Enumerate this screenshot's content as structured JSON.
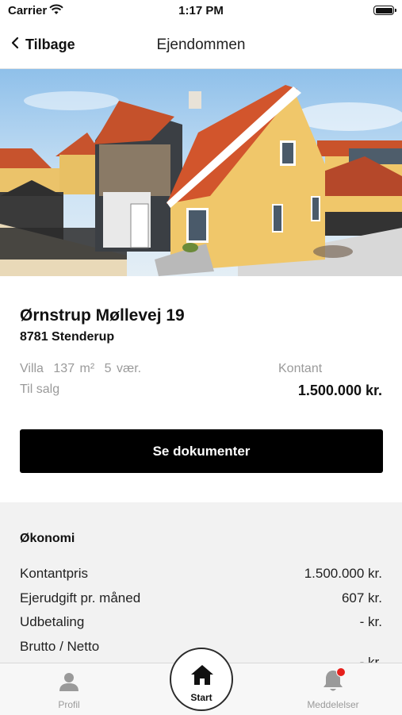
{
  "status_bar": {
    "carrier": "Carrier",
    "time": "1:17 PM"
  },
  "nav": {
    "back_label": "Tilbage",
    "title": "Ejendommen"
  },
  "property": {
    "address": "Ørnstrup Møllevej 19",
    "postal": "8781 Stenderup",
    "type": "Villa",
    "area": "137 m²",
    "rooms": "5 vær.",
    "status": "Til salg",
    "price_label": "Kontant",
    "price": "1.500.000 kr."
  },
  "actions": {
    "documents_button": "Se dokumenter"
  },
  "economy": {
    "title": "Økonomi",
    "rows": [
      {
        "label": "Kontantpris",
        "value": "1.500.000 kr."
      },
      {
        "label": "Ejerudgift pr. måned",
        "value": "607 kr."
      },
      {
        "label": "Udbetaling",
        "value": "- kr."
      },
      {
        "label": "Brutto / Netto",
        "value": "- kr."
      }
    ]
  },
  "tabbar": {
    "profile": "Profil",
    "home": "Start",
    "messages": "Meddelelser"
  },
  "colors": {
    "accent": "#000000",
    "badge": "#e6201c",
    "roof": "#d2552c",
    "wall": "#f0c76a"
  },
  "icons": {
    "back": "chevron-left-icon",
    "profile": "person-icon",
    "home": "home-icon",
    "messages": "bell-icon",
    "wifi": "wifi-icon",
    "battery": "battery-icon"
  }
}
